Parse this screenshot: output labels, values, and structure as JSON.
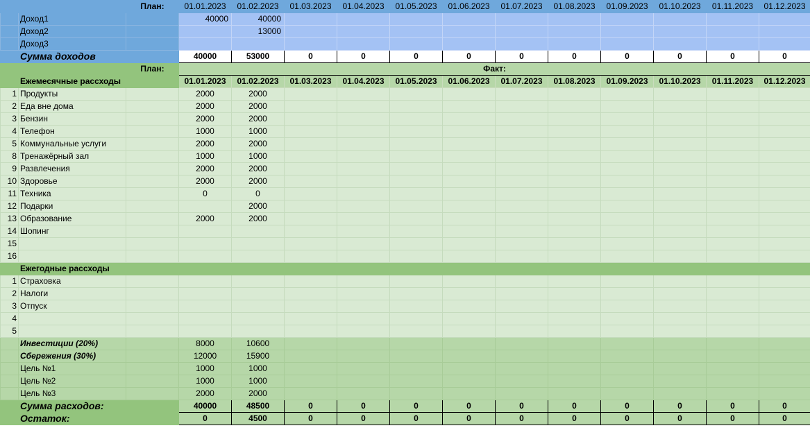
{
  "plan_label": "План:",
  "fact_label": "Факт:",
  "dates": [
    "01.01.2023",
    "01.02.2023",
    "01.03.2023",
    "01.04.2023",
    "01.05.2023",
    "01.06.2023",
    "01.07.2023",
    "01.08.2023",
    "01.09.2023",
    "01.10.2023",
    "01.11.2023",
    "01.12.2023"
  ],
  "income": {
    "rows": [
      {
        "label": "Доход1",
        "values": [
          "40000",
          "40000",
          "",
          "",
          "",
          "",
          "",
          "",
          "",
          "",
          "",
          ""
        ]
      },
      {
        "label": "Доход2",
        "values": [
          "",
          "13000",
          "",
          "",
          "",
          "",
          "",
          "",
          "",
          "",
          "",
          ""
        ]
      },
      {
        "label": "Доход3",
        "values": [
          "",
          "",
          "",
          "",
          "",
          "",
          "",
          "",
          "",
          "",
          "",
          ""
        ]
      }
    ],
    "sum_label": "Сумма доходов",
    "sum_values": [
      "40000",
      "53000",
      "0",
      "0",
      "0",
      "0",
      "0",
      "0",
      "0",
      "0",
      "0",
      "0"
    ]
  },
  "monthly": {
    "title": "Ежемесячные рассходы",
    "rows": [
      {
        "idx": "1",
        "label": "Продукты",
        "values": [
          "2000",
          "2000",
          "",
          "",
          "",
          "",
          "",
          "",
          "",
          "",
          "",
          ""
        ]
      },
      {
        "idx": "2",
        "label": "Еда вне дома",
        "values": [
          "2000",
          "2000",
          "",
          "",
          "",
          "",
          "",
          "",
          "",
          "",
          "",
          ""
        ]
      },
      {
        "idx": "3",
        "label": "Бензин",
        "values": [
          "2000",
          "2000",
          "",
          "",
          "",
          "",
          "",
          "",
          "",
          "",
          "",
          ""
        ]
      },
      {
        "idx": "4",
        "label": "Телефон",
        "values": [
          "1000",
          "1000",
          "",
          "",
          "",
          "",
          "",
          "",
          "",
          "",
          "",
          ""
        ]
      },
      {
        "idx": "5",
        "label": "Коммунальные услуги",
        "values": [
          "2000",
          "2000",
          "",
          "",
          "",
          "",
          "",
          "",
          "",
          "",
          "",
          ""
        ]
      },
      {
        "idx": "8",
        "label": "Тренажёрный зал",
        "values": [
          "1000",
          "1000",
          "",
          "",
          "",
          "",
          "",
          "",
          "",
          "",
          "",
          ""
        ]
      },
      {
        "idx": "9",
        "label": "Развлечения",
        "values": [
          "2000",
          "2000",
          "",
          "",
          "",
          "",
          "",
          "",
          "",
          "",
          "",
          ""
        ]
      },
      {
        "idx": "10",
        "label": "Здоровье",
        "values": [
          "2000",
          "2000",
          "",
          "",
          "",
          "",
          "",
          "",
          "",
          "",
          "",
          ""
        ]
      },
      {
        "idx": "11",
        "label": "Техника",
        "values": [
          "0",
          "0",
          "",
          "",
          "",
          "",
          "",
          "",
          "",
          "",
          "",
          ""
        ]
      },
      {
        "idx": "12",
        "label": "Подарки",
        "values": [
          "",
          "2000",
          "",
          "",
          "",
          "",
          "",
          "",
          "",
          "",
          "",
          ""
        ]
      },
      {
        "idx": "13",
        "label": "Образование",
        "values": [
          "2000",
          "2000",
          "",
          "",
          "",
          "",
          "",
          "",
          "",
          "",
          "",
          ""
        ]
      },
      {
        "idx": "14",
        "label": "Шопинг",
        "values": [
          "",
          "",
          "",
          "",
          "",
          "",
          "",
          "",
          "",
          "",
          "",
          ""
        ]
      },
      {
        "idx": "15",
        "label": "",
        "values": [
          "",
          "",
          "",
          "",
          "",
          "",
          "",
          "",
          "",
          "",
          "",
          ""
        ]
      },
      {
        "idx": "16",
        "label": "",
        "values": [
          "",
          "",
          "",
          "",
          "",
          "",
          "",
          "",
          "",
          "",
          "",
          ""
        ]
      }
    ]
  },
  "yearly": {
    "title": "Ежегодные рассходы",
    "rows": [
      {
        "idx": "1",
        "label": "Страховка",
        "values": [
          "",
          "",
          "",
          "",
          "",
          "",
          "",
          "",
          "",
          "",
          "",
          ""
        ]
      },
      {
        "idx": "2",
        "label": "Налоги",
        "values": [
          "",
          "",
          "",
          "",
          "",
          "",
          "",
          "",
          "",
          "",
          "",
          ""
        ]
      },
      {
        "idx": "3",
        "label": "Отпуск",
        "values": [
          "",
          "",
          "",
          "",
          "",
          "",
          "",
          "",
          "",
          "",
          "",
          ""
        ]
      },
      {
        "idx": "4",
        "label": "",
        "values": [
          "",
          "",
          "",
          "",
          "",
          "",
          "",
          "",
          "",
          "",
          "",
          ""
        ]
      },
      {
        "idx": "5",
        "label": "",
        "values": [
          "",
          "",
          "",
          "",
          "",
          "",
          "",
          "",
          "",
          "",
          "",
          ""
        ]
      }
    ]
  },
  "savings": {
    "rows": [
      {
        "label": "Инвестиции  (20%)",
        "style": "bi",
        "values": [
          "8000",
          "10600",
          "",
          "",
          "",
          "",
          "",
          "",
          "",
          "",
          "",
          ""
        ]
      },
      {
        "label": "Сбережения (30%)",
        "style": "bi",
        "values": [
          "12000",
          "15900",
          "",
          "",
          "",
          "",
          "",
          "",
          "",
          "",
          "",
          ""
        ]
      },
      {
        "label": "Цель №1",
        "style": "",
        "values": [
          "1000",
          "1000",
          "",
          "",
          "",
          "",
          "",
          "",
          "",
          "",
          "",
          ""
        ]
      },
      {
        "label": "Цель №2",
        "style": "",
        "values": [
          "1000",
          "1000",
          "",
          "",
          "",
          "",
          "",
          "",
          "",
          "",
          "",
          ""
        ]
      },
      {
        "label": "Цель №3",
        "style": "",
        "values": [
          "2000",
          "2000",
          "",
          "",
          "",
          "",
          "",
          "",
          "",
          "",
          "",
          ""
        ]
      }
    ]
  },
  "totals": {
    "expense_label": "Сумма расходов:",
    "expense_values": [
      "40000",
      "48500",
      "0",
      "0",
      "0",
      "0",
      "0",
      "0",
      "0",
      "0",
      "0",
      "0"
    ],
    "rest_label": "Остаток:",
    "rest_values": [
      "0",
      "4500",
      "0",
      "0",
      "0",
      "0",
      "0",
      "0",
      "0",
      "0",
      "0",
      "0"
    ]
  }
}
